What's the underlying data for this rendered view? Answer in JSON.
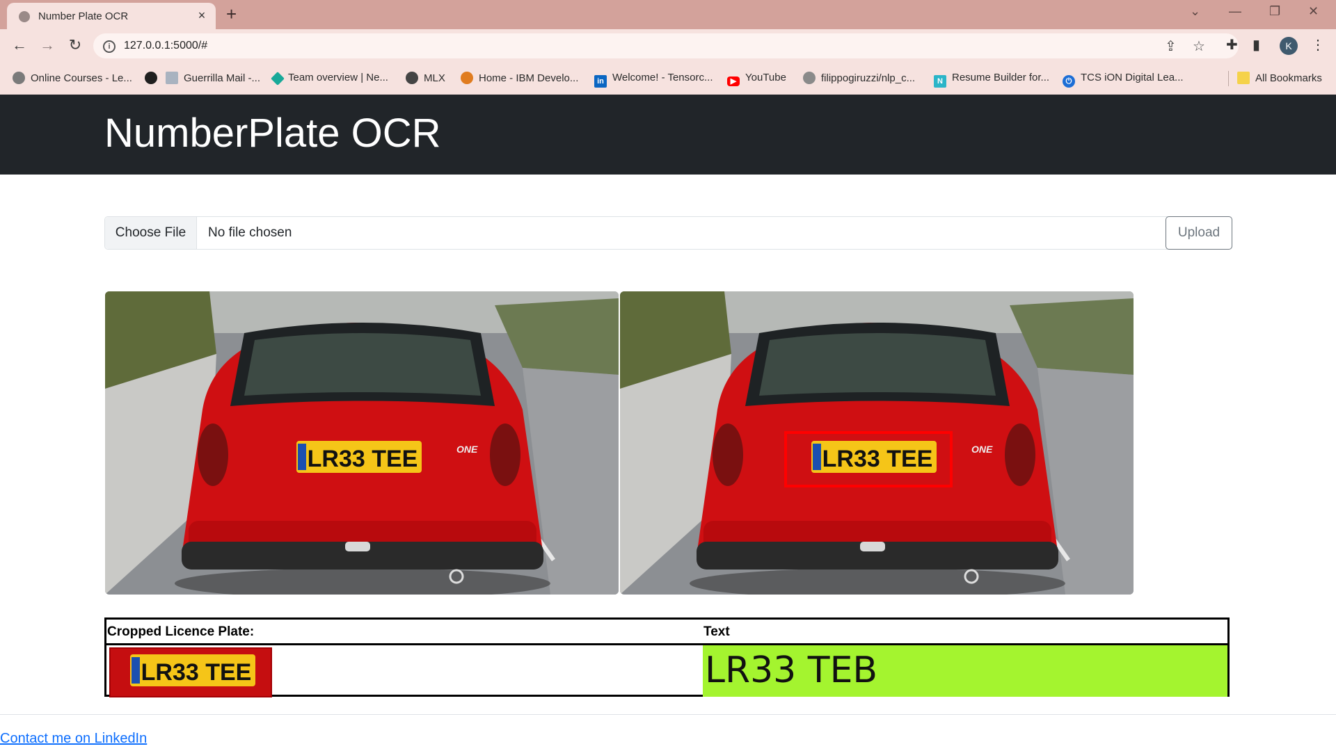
{
  "browser": {
    "tab_title": "Number Plate OCR",
    "tab_close_icon": "×",
    "new_tab_icon": "+",
    "url": "127.0.0.1:5000/#",
    "profile_initial": "K",
    "window_controls": [
      "⌄",
      "—",
      "❐",
      "✕"
    ],
    "nav": {
      "back": "←",
      "forward": "→",
      "reload": "↻"
    }
  },
  "bookmarks": {
    "items": [
      {
        "label": "Online Courses - Le...",
        "icon": "github-icon",
        "color": "#6e6e6e"
      },
      {
        "label": "",
        "icon": "github-icon",
        "color": "#1f1f1f"
      },
      {
        "label": "Guerrilla Mail -...",
        "icon": "mail-icon",
        "color": "#a9b3c0"
      },
      {
        "label": "Team overview | Ne...",
        "icon": "diamond-icon",
        "color": "#18a999"
      },
      {
        "label": "MLX",
        "icon": "globe-icon",
        "color": "#444"
      },
      {
        "label": "Home - IBM Develo...",
        "icon": "ibm-icon",
        "color": "#e07c1f"
      },
      {
        "label": "Welcome! - Tensorc...",
        "icon": "linkedin-icon",
        "color": "#0a66c2"
      },
      {
        "label": "YouTube",
        "icon": "youtube-icon",
        "color": "#ff0000"
      },
      {
        "label": "filippogiruzzi/nlp_c...",
        "icon": "github-icon",
        "color": "#6e6e6e"
      },
      {
        "label": "Resume Builder for...",
        "icon": "novoresume-icon",
        "color": "#2bb5c8"
      },
      {
        "label": "TCS iON Digital Lea...",
        "icon": "power-icon",
        "color": "#1c6ed6"
      }
    ],
    "all_bookmarks": "All Bookmarks"
  },
  "page": {
    "brand": "NumberPlate OCR",
    "file_input": {
      "button": "Choose File",
      "status": "No file chosen"
    },
    "upload_button": "Upload",
    "images": {
      "plate_text": "LR33 TEE",
      "badge": "ONE"
    },
    "table": {
      "col1_header": "Cropped Licence Plate:",
      "col2_header": "Text",
      "ocr_result": "LR33 TEB",
      "result_bg": "#a4f42f"
    },
    "footer_link": "Contact me on LinkedIn"
  }
}
